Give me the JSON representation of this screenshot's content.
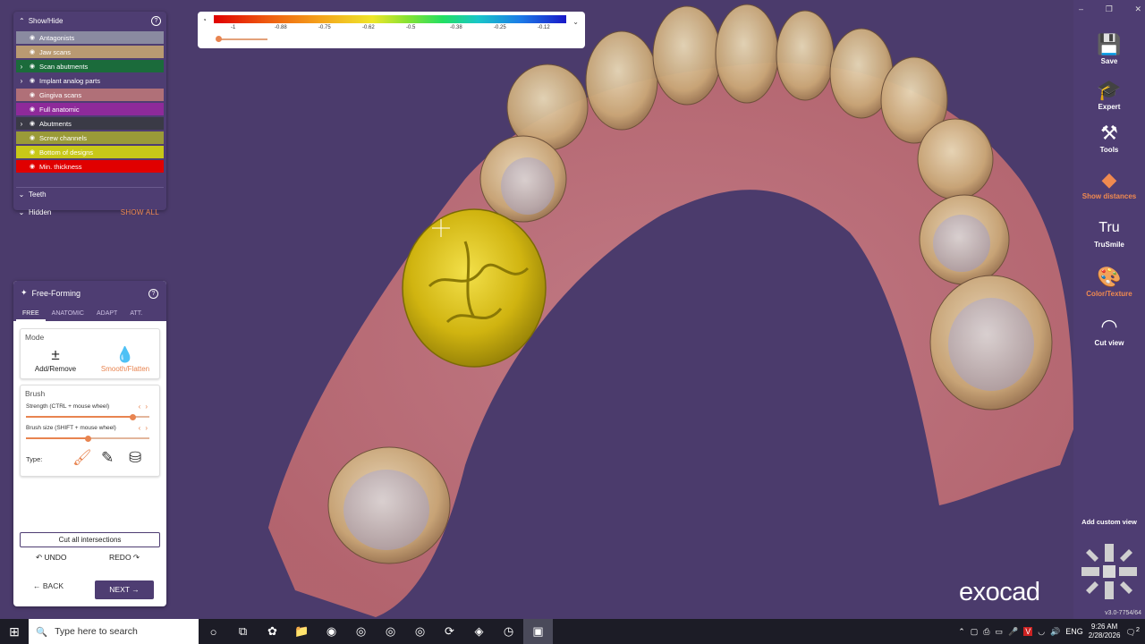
{
  "showhide": {
    "title": "Show/Hide",
    "layers": [
      {
        "label": "Antagonists",
        "color": "#8a8aa0",
        "expand": false
      },
      {
        "label": "Jaw scans",
        "color": "#b99a72",
        "expand": false
      },
      {
        "label": "Scan abutments",
        "color": "#1b6b3b",
        "expand": true
      },
      {
        "label": "Implant analog parts",
        "color": "#4e3d72",
        "expand": true
      },
      {
        "label": "Gingiva scans",
        "color": "#b07078",
        "expand": false
      },
      {
        "label": "Full anatomic",
        "color": "#8e2a9a",
        "expand": false
      },
      {
        "label": "Abutments",
        "color": "#3a3a46",
        "expand": true
      },
      {
        "label": "Screw channels",
        "color": "#9a9a38",
        "expand": false
      },
      {
        "label": "Bottom of designs",
        "color": "#c8c818",
        "expand": false
      },
      {
        "label": "Min. thickness",
        "color": "#e00000",
        "expand": false
      }
    ],
    "teeth": "Teeth",
    "hidden": "Hidden",
    "show_all": "SHOW ALL"
  },
  "scale": {
    "ticks": [
      "-1",
      "-0.88",
      "-0.75",
      "-0.62",
      "-0.5",
      "-0.38",
      "-0.25",
      "-0.12"
    ]
  },
  "freeforming": {
    "title": "Free-Forming",
    "tabs": [
      "FREE",
      "ANATOMIC",
      "ADAPT",
      "ATT."
    ],
    "mode_caption": "Mode",
    "add_remove": "Add/Remove",
    "smooth_flatten": "Smooth/Flatten",
    "brush_caption": "Brush",
    "strength_label": "Strength (CTRL + mouse wheel)",
    "strength_level": 0.86,
    "size_label": "Brush size (SHIFT + mouse wheel)",
    "size_level": 0.5,
    "type_label": "Type:",
    "cut_all": "Cut all intersections",
    "undo": "UNDO",
    "redo": "REDO",
    "back": "BACK",
    "next": "NEXT"
  },
  "toolbar": {
    "save": "Save",
    "expert": "Expert",
    "tools": "Tools",
    "show_distances": "Show distances",
    "trusmile": "TruSmile",
    "color_texture": "Color/Texture",
    "cut_view": "Cut view",
    "add_custom_view": "Add custom view",
    "version": "v3.0-7754/64"
  },
  "logo": "exocad",
  "taskbar": {
    "search_placeholder": "Type here to search",
    "lang": "ENG",
    "time": "9:26 AM",
    "date": "2/28/2026",
    "notif_count": "2"
  }
}
